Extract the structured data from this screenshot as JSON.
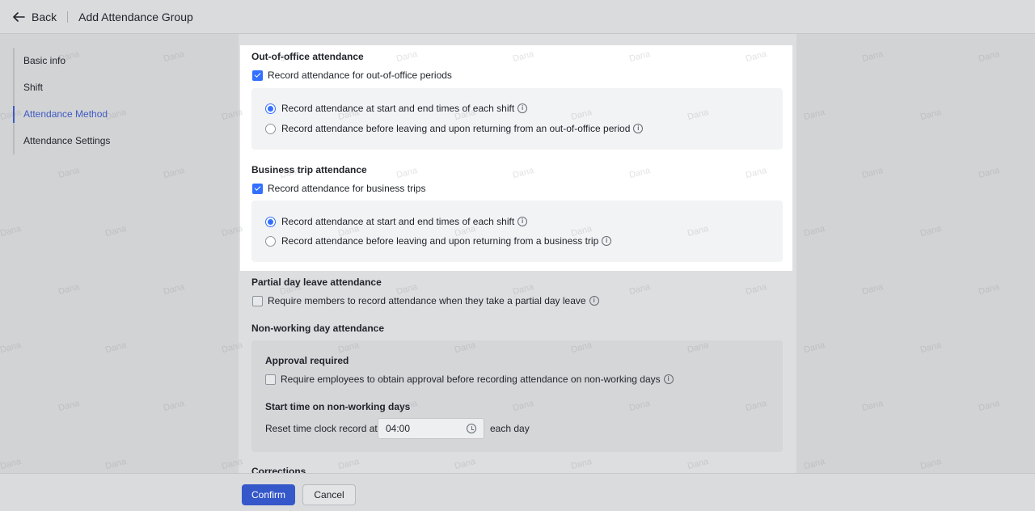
{
  "header": {
    "back_label": "Back",
    "title": "Add Attendance Group"
  },
  "sidenav": {
    "items": [
      {
        "label": "Basic info",
        "active": false
      },
      {
        "label": "Shift",
        "active": false
      },
      {
        "label": "Attendance Method",
        "active": true
      },
      {
        "label": "Attendance Settings",
        "active": false
      }
    ]
  },
  "out_of_office": {
    "title": "Out-of-office attendance",
    "checkbox_label": "Record attendance for out-of-office periods",
    "checked": true,
    "options": [
      {
        "label": "Record attendance at start and end times of each shift",
        "selected": true
      },
      {
        "label": "Record attendance before leaving and upon returning from an out-of-office period",
        "selected": false
      }
    ]
  },
  "business_trip": {
    "title": "Business trip attendance",
    "checkbox_label": "Record attendance for business trips",
    "checked": true,
    "options": [
      {
        "label": "Record attendance at start and end times of each shift",
        "selected": true
      },
      {
        "label": "Record attendance before leaving and upon returning from a business trip",
        "selected": false
      }
    ]
  },
  "partial_day": {
    "title": "Partial day leave attendance",
    "checkbox_label": "Require members to record attendance when they take a partial day leave",
    "checked": false
  },
  "non_working": {
    "title": "Non-working day attendance",
    "approval_title": "Approval required",
    "approval_label": "Require employees to obtain approval before recording attendance on non-working days",
    "approval_checked": false,
    "start_time_title": "Start time on non-working days",
    "reset_label": "Reset time clock record at",
    "time_value": "04:00",
    "each_day": "each day"
  },
  "corrections": {
    "title": "Corrections"
  },
  "footer": {
    "confirm_label": "Confirm",
    "cancel_label": "Cancel"
  },
  "watermark": "Dana",
  "colors": {
    "accent": "#3370ff",
    "primary_button": "#3457c9",
    "active_nav": "#3d5bc2"
  }
}
